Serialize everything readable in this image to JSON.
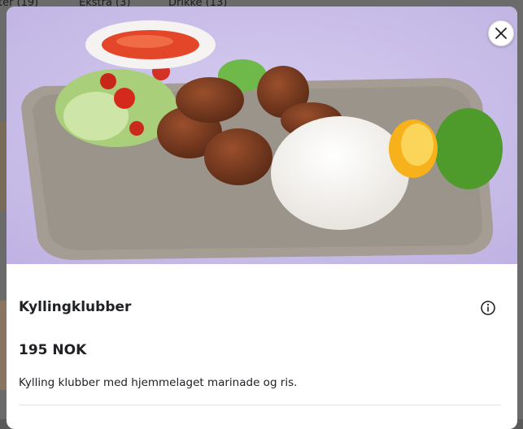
{
  "background": {
    "tabs": [
      {
        "label": "ter (19)"
      },
      {
        "label": "Ekstra (3)"
      },
      {
        "label": "Drikke (13)"
      }
    ]
  },
  "modal": {
    "image_alt": "Kyllingklubber",
    "close_icon": "close-icon",
    "info_icon": "info-icon",
    "title": "Kyllingklubber",
    "price": "195 NOK",
    "description": "Kylling klubber med hjemmelaget marinade og ris."
  },
  "colors": {
    "text": "#202125",
    "overlay": "#6b6b6b",
    "hero_background": "#cbbfe9",
    "plate": "#a59d93"
  }
}
